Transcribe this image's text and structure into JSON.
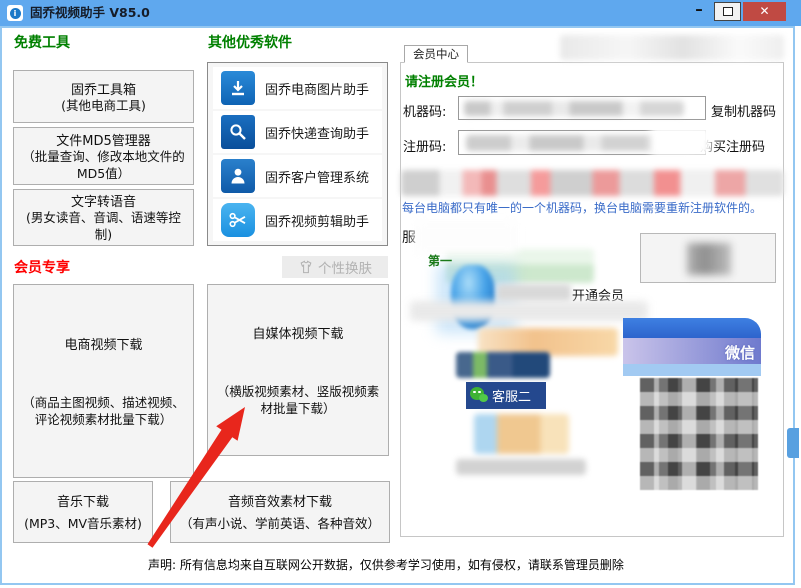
{
  "titlebar": {
    "title": "固乔视频助手 V85.0"
  },
  "window_controls": {
    "minimize": "–",
    "close": "✕"
  },
  "headings": {
    "free_tools": "免费工具",
    "other_software": "其他优秀软件",
    "vip_only": "会员专享"
  },
  "free_tools": [
    {
      "title": "固乔工具箱",
      "subtitle": "(其他电商工具)"
    },
    {
      "title": "文件MD5管理器",
      "subtitle": "（批量查询、修改本地文件的MD5值）"
    },
    {
      "title": "文字转语音",
      "subtitle": "(男女读音、音调、语速等控制)"
    }
  ],
  "other_software": [
    {
      "label": "固乔电商图片助手"
    },
    {
      "label": "固乔快递查询助手"
    },
    {
      "label": "固乔客户管理系统"
    },
    {
      "label": "固乔视频剪辑助手"
    }
  ],
  "skin_button": {
    "label": "个性换肤"
  },
  "vip_buttons": {
    "ecommerce": {
      "title": "电商视频下载",
      "subtitle": "（商品主图视频、描述视频、评论视频素材批量下载）"
    },
    "media": {
      "title": "自媒体视频下载",
      "subtitle": "（横版视频素材、竖版视频素材批量下载）"
    },
    "music": {
      "title": "音乐下载",
      "subtitle": "(MP3、MV音乐素材)"
    },
    "audio": {
      "title": "音频音效素材下载",
      "subtitle": "（有声小说、学前英语、各种音效）"
    }
  },
  "member_panel": {
    "tab": "会员中心",
    "register_prompt": "请注册会员！",
    "machine_code_label": "机器码:",
    "copy_machine_code": "复制机器码",
    "reg_code_label": "注册码:",
    "buy_reg_code": "购买注册码",
    "unique_note": "每台电脑都只有唯一的一个机器码，换台电脑需要重新注册软件的。",
    "service_prefix": "服",
    "tier_label": "第一",
    "open_vip_suffix": "开通会员",
    "wechat_badge": "客服二",
    "banner_wechat": "微信"
  },
  "footer": {
    "statement": "声明: 所有信息均来自互联网公开数据，仅供参考学习使用，如有侵权，请联系管理员删除"
  },
  "colors": {
    "titlebar": "#5fa8ee",
    "close_button": "#c04a43",
    "heading_green": "#008000",
    "heading_red": "#ff0000",
    "note_blue": "#3a6bc8",
    "icon_blue": "#1878c8",
    "arrow_red": "#e8261c"
  }
}
